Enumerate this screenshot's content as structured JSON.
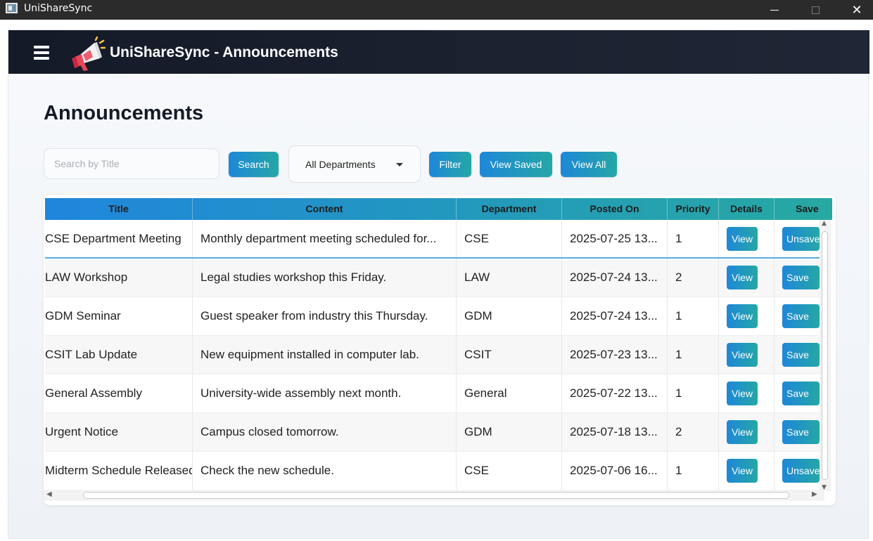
{
  "window": {
    "title": "UniShareSync",
    "minimize_glyph": "—",
    "close_glyph": "✕"
  },
  "header": {
    "title": "UniShareSync - Announcements",
    "logo_icon": "megaphone-icon",
    "menu_icon": "hamburger-icon"
  },
  "page": {
    "heading": "Announcements"
  },
  "toolbar": {
    "search_placeholder": "Search by Title",
    "search_value": "",
    "search_label": "Search",
    "department_selected": "All Departments",
    "filter_label": "Filter",
    "view_saved_label": "View Saved",
    "view_all_label": "View All"
  },
  "table": {
    "columns": [
      "Title",
      "Content",
      "Department",
      "Posted On",
      "Priority",
      "Details",
      "Save"
    ],
    "rows": [
      {
        "title": "CSE Department Meeting",
        "content": "Monthly department meeting scheduled for...",
        "department": "CSE",
        "posted_on": "2025-07-25 13...",
        "priority": "1",
        "details": "View",
        "save": "Unsave"
      },
      {
        "title": "LAW Workshop",
        "content": "Legal studies workshop this Friday.",
        "department": "LAW",
        "posted_on": "2025-07-24 13...",
        "priority": "2",
        "details": "View",
        "save": "Save"
      },
      {
        "title": "GDM Seminar",
        "content": "Guest speaker from industry this Thursday.",
        "department": "GDM",
        "posted_on": "2025-07-24 13...",
        "priority": "1",
        "details": "View",
        "save": "Save"
      },
      {
        "title": "CSIT Lab Update",
        "content": "New equipment installed in computer lab.",
        "department": "CSIT",
        "posted_on": "2025-07-23 13...",
        "priority": "1",
        "details": "View",
        "save": "Save"
      },
      {
        "title": "General Assembly",
        "content": "University-wide assembly next month.",
        "department": "General",
        "posted_on": "2025-07-22 13...",
        "priority": "1",
        "details": "View",
        "save": "Save"
      },
      {
        "title": "Urgent Notice",
        "content": "Campus closed tomorrow.",
        "department": "GDM",
        "posted_on": "2025-07-18 13...",
        "priority": "2",
        "details": "View",
        "save": "Save"
      },
      {
        "title": "Midterm Schedule Released",
        "content": "Check the new schedule.",
        "department": "CSE",
        "posted_on": "2025-07-06 16...",
        "priority": "1",
        "details": "View",
        "save": "Unsave"
      }
    ]
  },
  "colors": {
    "accent_start": "#1e87d8",
    "accent_end": "#25a7a5",
    "header_bg": "#141a27"
  }
}
